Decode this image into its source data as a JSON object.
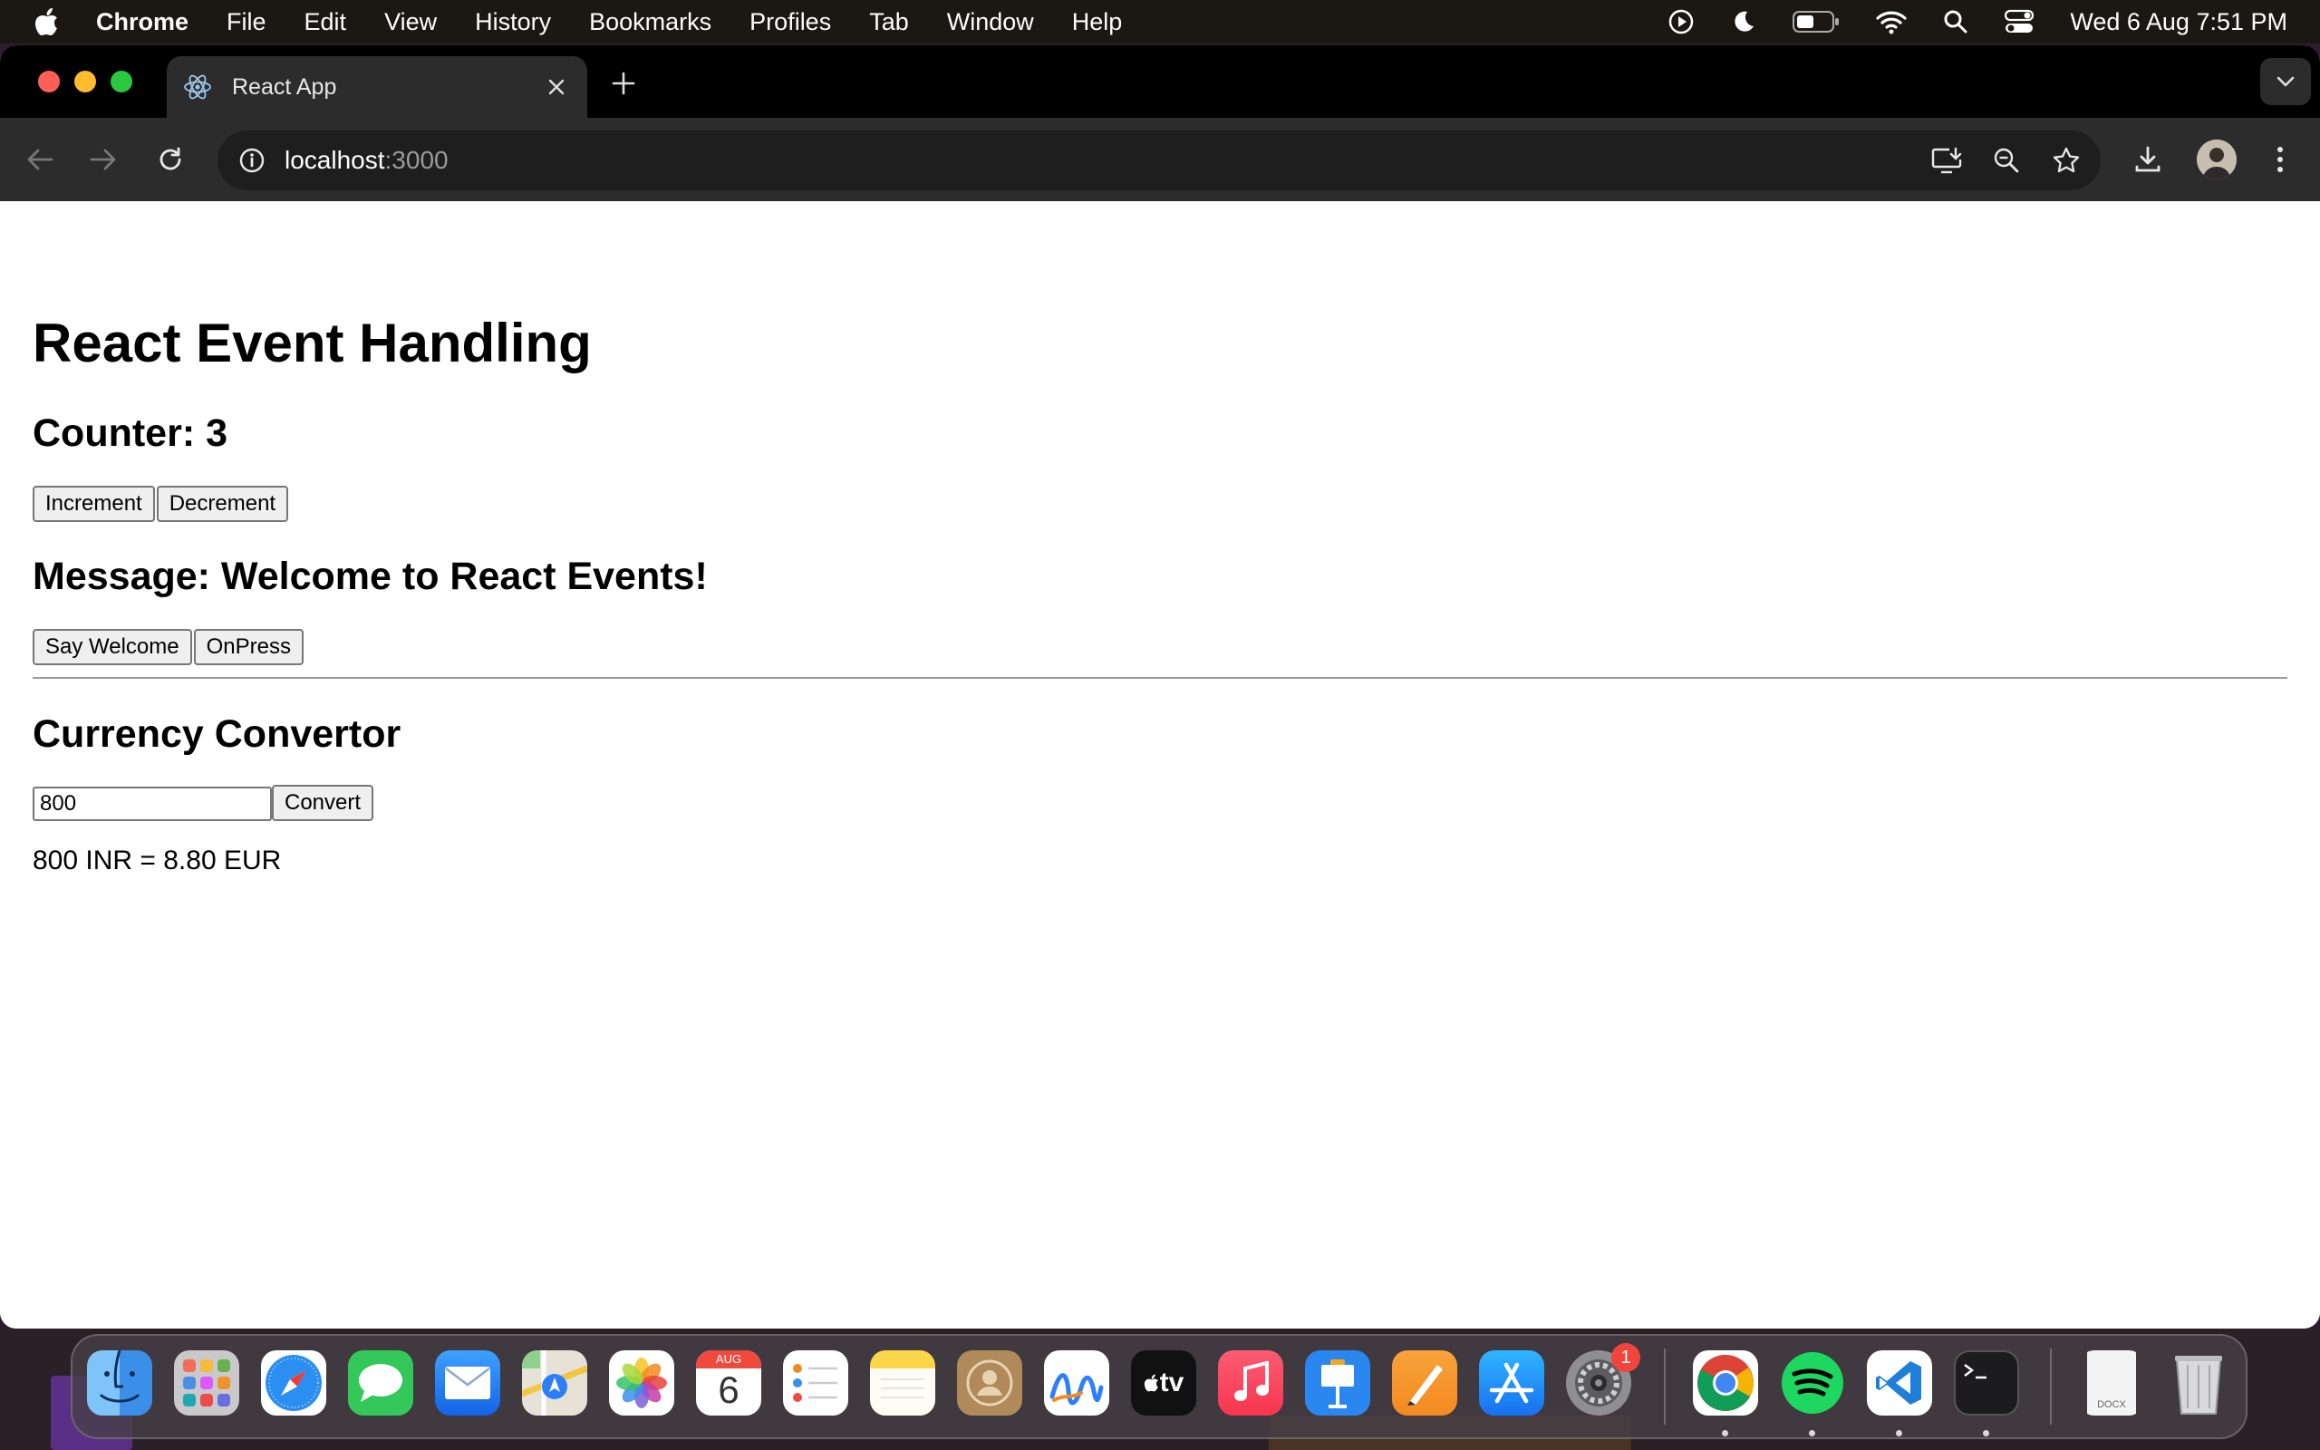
{
  "menubar": {
    "app_name": "Chrome",
    "items": [
      "File",
      "Edit",
      "View",
      "History",
      "Bookmarks",
      "Profiles",
      "Tab",
      "Window",
      "Help"
    ],
    "clock": "Wed 6 Aug  7:51 PM"
  },
  "browser": {
    "tab_title": "React App",
    "url_host": "localhost",
    "url_port": ":3000"
  },
  "page": {
    "title": "React Event Handling",
    "counter_heading": "Counter: 3",
    "increment_label": "Increment",
    "decrement_label": "Decrement",
    "message_heading": "Message: Welcome to React Events!",
    "say_welcome_label": "Say Welcome",
    "onpress_label": "OnPress",
    "currency_heading": "Currency Convertor",
    "amount_value": "800",
    "convert_label": "Convert",
    "result_text": "800 INR = 8.80 EUR"
  },
  "dock": {
    "calendar_month": "AUG",
    "calendar_day": "6",
    "settings_badge": "1",
    "appletv_label": "tv",
    "docx_label": "DOCX",
    "apps": [
      "Finder",
      "Launchpad",
      "Safari",
      "Messages",
      "Mail",
      "Maps",
      "Photos",
      "Calendar",
      "Reminders",
      "Notes",
      "Contacts",
      "Freeform",
      "Apple TV",
      "Music",
      "Keynote",
      "Pages",
      "App Store",
      "System Settings",
      "Google Chrome",
      "Spotify",
      "Visual Studio Code",
      "Terminal",
      "Document",
      "Trash"
    ]
  },
  "colors": {
    "menubar_bg": "#1b1712",
    "tab_bg": "#2c2c2c",
    "omnibox_bg": "#1e1e1e",
    "page_bg": "#ffffff",
    "close_red": "#fe5f57",
    "minimize_yellow": "#febc2e",
    "zoom_green": "#28c840"
  }
}
